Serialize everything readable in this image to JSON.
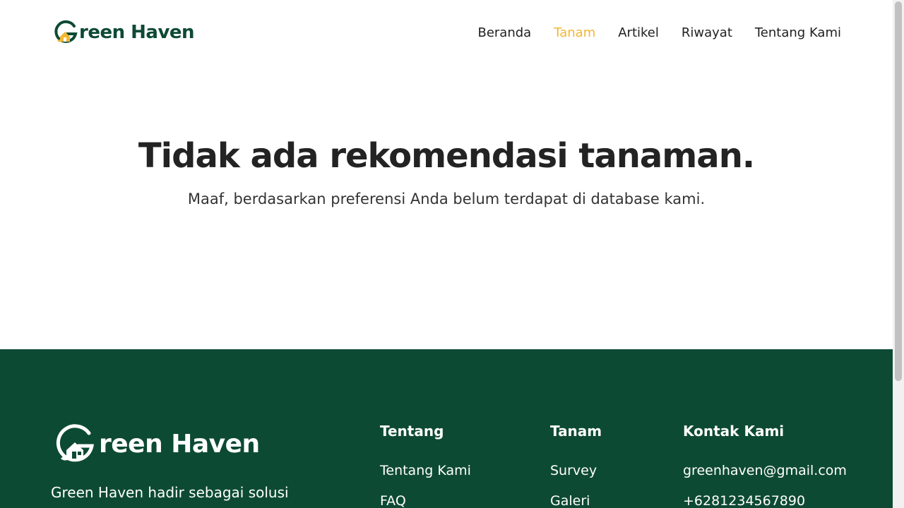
{
  "brand": {
    "name_rest": "reen Haven",
    "name_full": "Green Haven",
    "primary_color": "#0d4a34",
    "accent_color": "#f2b632"
  },
  "nav": {
    "items": [
      {
        "label": "Beranda",
        "active": false
      },
      {
        "label": "Tanam",
        "active": true
      },
      {
        "label": "Artikel",
        "active": false
      },
      {
        "label": "Riwayat",
        "active": false
      },
      {
        "label": "Tentang Kami",
        "active": false
      }
    ]
  },
  "main": {
    "title": "Tidak ada rekomendasi tanaman.",
    "subtitle": "Maaf, berdasarkan preferensi Anda belum terdapat di database kami."
  },
  "footer": {
    "logo_text": "reen Haven",
    "description": "Green Haven hadir sebagai solusi",
    "tentang": {
      "heading": "Tentang",
      "links": [
        "Tentang Kami",
        "FAQ"
      ]
    },
    "tanam": {
      "heading": "Tanam",
      "links": [
        "Survey",
        "Galeri"
      ]
    },
    "kontak": {
      "heading": "Kontak Kami",
      "email": "greenhaven@gmail.com",
      "phone": "+6281234567890"
    }
  }
}
